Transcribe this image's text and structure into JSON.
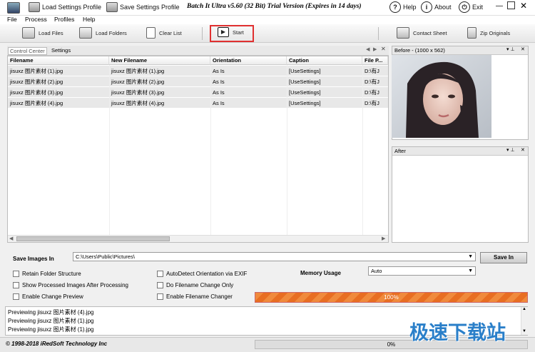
{
  "titlebar": {
    "load_profile": "Load Settings Profile",
    "save_profile": "Save Settings Profile",
    "title": "Batch It Ultra v5.60 (32 Bit) Trial Version (Expires in 14 days)",
    "help": "Help",
    "about": "About",
    "exit": "Exit"
  },
  "menu": [
    "File",
    "Process",
    "Profiles",
    "Help"
  ],
  "toolbar": {
    "load_files": "Load Files",
    "load_folders": "Load Folders",
    "clear_list": "Clear List",
    "start": "Start",
    "contact_sheet": "Contact Sheet",
    "zip_originals": "Zip Originals"
  },
  "tabs": [
    "Control Center",
    "Settings"
  ],
  "grid": {
    "headers": [
      "Filename",
      "New Filename",
      "Orientation",
      "Caption",
      "File P..."
    ],
    "rows": [
      [
        "jisuxz 图片素材 (1).jpg",
        "jisuxz 图片素材 (1).jpg",
        "As Is",
        "[UseSettings]",
        "D:\\有J"
      ],
      [
        "jisuxz 图片素材 (2).jpg",
        "jisuxz 图片素材 (2).jpg",
        "As Is",
        "[UseSettings]",
        "D:\\有J"
      ],
      [
        "jisuxz 图片素材 (3).jpg",
        "jisuxz 图片素材 (3).jpg",
        "As Is",
        "[UseSettings]",
        "D:\\有J"
      ],
      [
        "jisuxz 图片素材 (4).jpg",
        "jisuxz 图片素材 (4).jpg",
        "As Is",
        "[UseSettings]",
        "D:\\有J"
      ]
    ]
  },
  "preview": {
    "before": "Before - (1000 x 562)",
    "after": "After"
  },
  "options": {
    "save_images_in": "Save Images In",
    "path": "C:\\Users\\Public\\Pictures\\",
    "save_in": "Save In",
    "retain": "Retain Folder Structure",
    "show_processed": "Show Processed Images After Processing",
    "enable_change_preview": "Enable Change Preview",
    "autodetect": "AutoDetect Orientation via EXIF",
    "do_filename": "Do Filename Change Only",
    "enable_filename": "Enable Filename Changer",
    "memory_usage": "Memory Usage",
    "memory_value": "Auto",
    "progress_text": "100%"
  },
  "progress": {
    "value": 100
  },
  "log": [
    "Previewing jisuxz 图片素材 (4).jpg",
    "Previewing jisuxz 图片素材 (1).jpg",
    "Previewing jisuxz 图片素材 (1).jpg"
  ],
  "status": {
    "copyright": "© 1998-2018 iRedSoft Technology Inc",
    "percent": "0%",
    "watermark": "极速下载站"
  },
  "colors": {
    "accent": "#f08a3c",
    "highlight": "#e03030"
  }
}
